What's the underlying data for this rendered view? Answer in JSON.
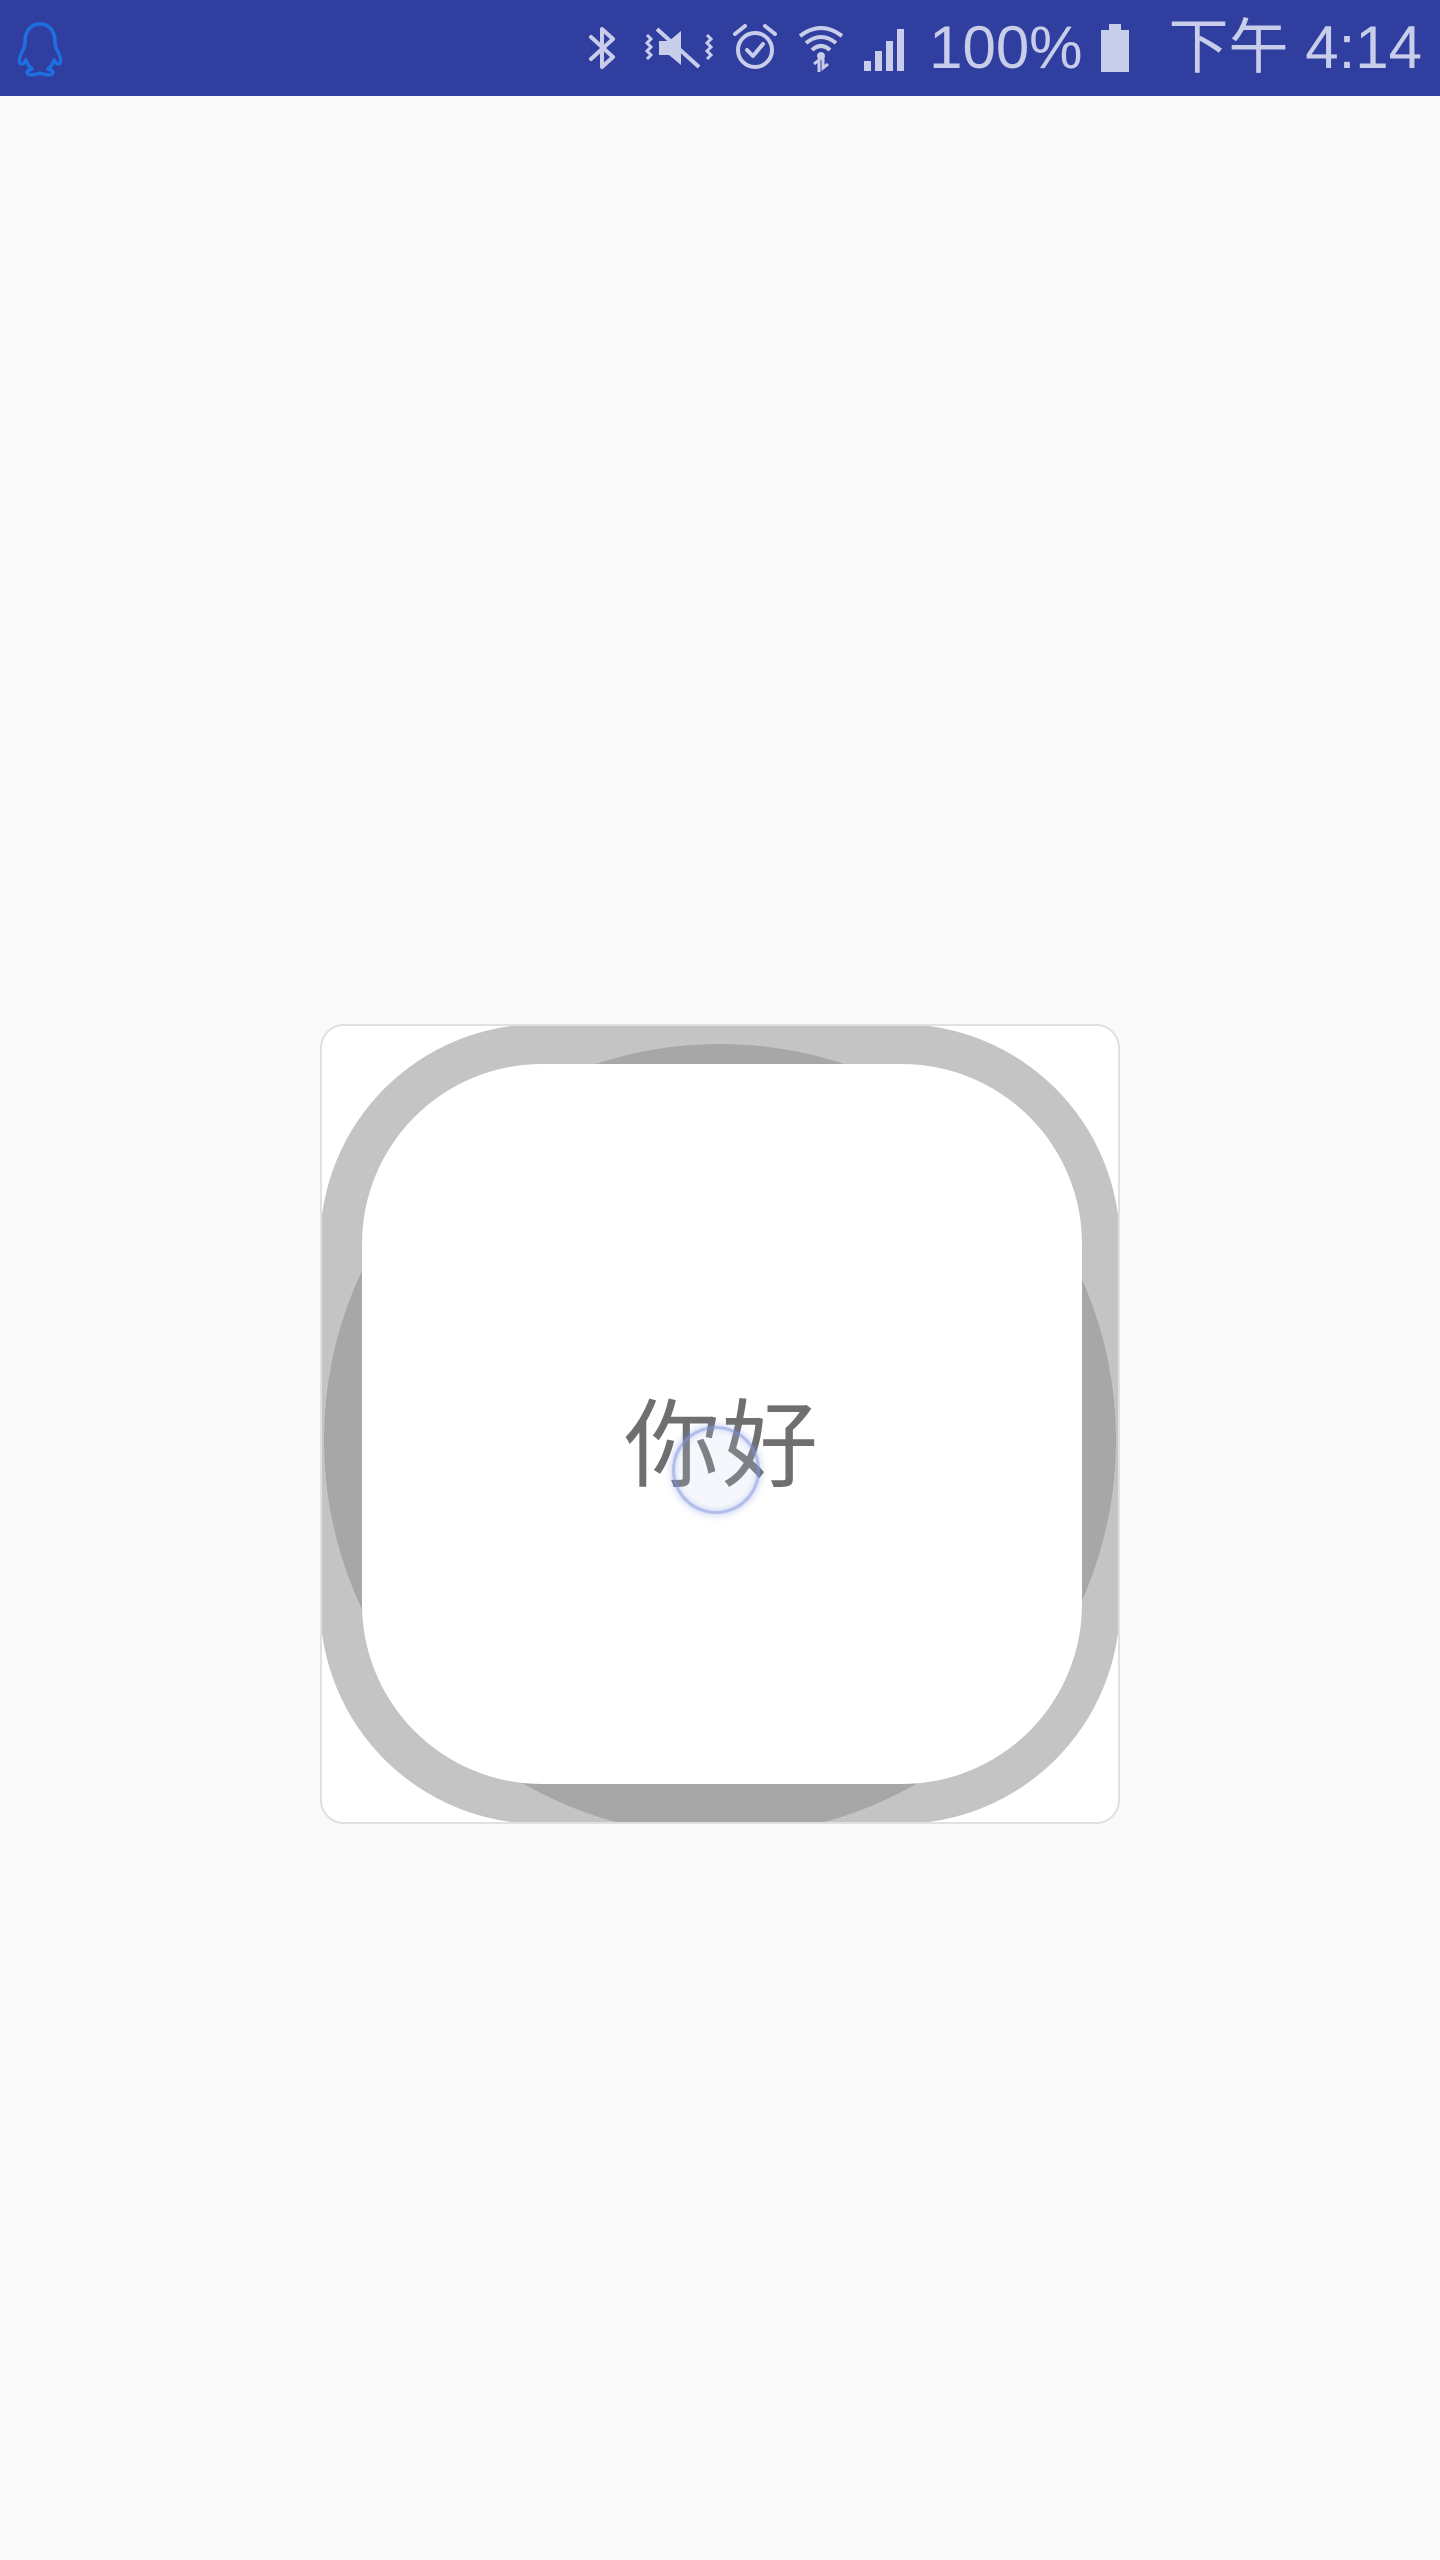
{
  "status_bar": {
    "app_icon": "qq-penguin-icon",
    "icons": [
      "bluetooth-icon",
      "vibrate-mute-icon",
      "alarm-icon",
      "wifi-icon",
      "cell-signal-icon",
      "battery-icon"
    ],
    "battery_percent": "100%",
    "time": "下午 4:14",
    "background_color": "#303f9f",
    "icon_color": "#c8cdea",
    "app_icon_color": "#1e6fe0"
  },
  "main": {
    "greeting": "你好",
    "background_color": "#f9f9f9"
  },
  "icon_card": {
    "shape_colors": {
      "outer_squircle": "#c4c4c4",
      "circle": "#a7a7a7",
      "inner_squircle": "#ffffff"
    }
  }
}
